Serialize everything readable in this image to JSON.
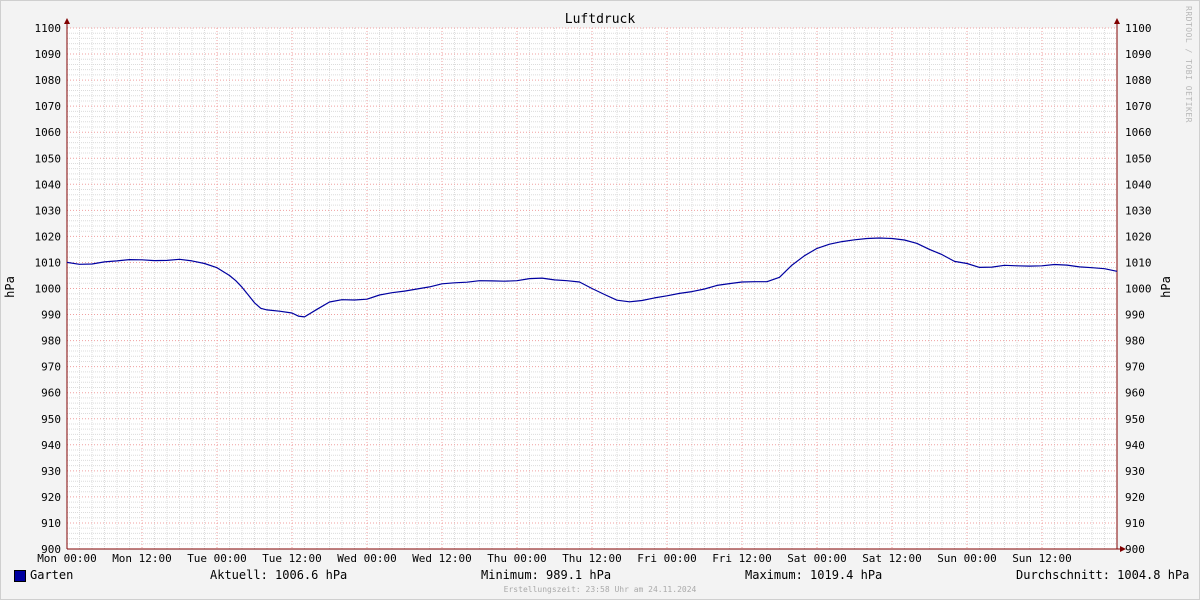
{
  "chart_data": {
    "type": "line",
    "title": "Luftdruck",
    "xlabel": "",
    "ylabel": "hPa",
    "ylabel_right": "hPa",
    "ylim": [
      900,
      1100
    ],
    "yticks": [
      900,
      910,
      920,
      930,
      940,
      950,
      960,
      970,
      980,
      990,
      1000,
      1010,
      1020,
      1030,
      1040,
      1050,
      1060,
      1070,
      1080,
      1090,
      1100
    ],
    "xlim": [
      0,
      168
    ],
    "xticks": [
      {
        "value": 0,
        "label": "Mon 00:00"
      },
      {
        "value": 12,
        "label": "Mon 12:00"
      },
      {
        "value": 24,
        "label": "Tue 00:00"
      },
      {
        "value": 36,
        "label": "Tue 12:00"
      },
      {
        "value": 48,
        "label": "Wed 00:00"
      },
      {
        "value": 60,
        "label": "Wed 12:00"
      },
      {
        "value": 72,
        "label": "Thu 00:00"
      },
      {
        "value": 84,
        "label": "Thu 12:00"
      },
      {
        "value": 96,
        "label": "Fri 00:00"
      },
      {
        "value": 108,
        "label": "Fri 12:00"
      },
      {
        "value": 120,
        "label": "Sat 00:00"
      },
      {
        "value": 132,
        "label": "Sat 12:00"
      },
      {
        "value": 144,
        "label": "Sun 00:00"
      },
      {
        "value": 156,
        "label": "Sun 12:00"
      }
    ],
    "grid": true,
    "series": [
      {
        "name": "Garten",
        "color": "#0000a0",
        "x": [
          0,
          2,
          4,
          6,
          8,
          10,
          12,
          14,
          16,
          18,
          20,
          22,
          24,
          26,
          27,
          28,
          29,
          30,
          31,
          32,
          34,
          36,
          37,
          38,
          40,
          42,
          44,
          46,
          48,
          50,
          52,
          54,
          56,
          58,
          60,
          62,
          64,
          66,
          68,
          70,
          72,
          74,
          76,
          78,
          80,
          82,
          84,
          86,
          88,
          90,
          92,
          94,
          96,
          98,
          100,
          102,
          104,
          106,
          108,
          110,
          112,
          114,
          116,
          118,
          120,
          122,
          124,
          126,
          128,
          130,
          132,
          134,
          136,
          138,
          140,
          142,
          144,
          146,
          148,
          150,
          152,
          154,
          156,
          158,
          160,
          162,
          164,
          166,
          168
        ],
        "values": [
          1010,
          1009.3,
          1009.4,
          1010.2,
          1010.6,
          1011.1,
          1011.0,
          1010.7,
          1010.8,
          1011.2,
          1010.6,
          1009.6,
          1008.0,
          1005.0,
          1003.0,
          1000.5,
          997.5,
          994.5,
          992.4,
          991.8,
          991.3,
          990.6,
          989.4,
          989.1,
          992.0,
          994.8,
          995.7,
          995.6,
          995.9,
          997.5,
          998.4,
          999.0,
          999.8,
          1000.6,
          1001.8,
          1002.2,
          1002.4,
          1003.0,
          1002.9,
          1002.8,
          1003.0,
          1003.8,
          1004.0,
          1003.3,
          1003.0,
          1002.5,
          1000.0,
          997.7,
          995.5,
          994.9,
          995.4,
          996.4,
          997.2,
          998.1,
          998.8,
          999.8,
          1001.2,
          1001.9,
          1002.5,
          1002.6,
          1002.6,
          1004.3,
          1009.0,
          1012.6,
          1015.4,
          1017.0,
          1018.0,
          1018.7,
          1019.2,
          1019.4,
          1019.2,
          1018.6,
          1017.3,
          1015.0,
          1013.0,
          1010.4,
          1009.6,
          1008.1,
          1008.2,
          1008.9,
          1008.7,
          1008.6,
          1008.7,
          1009.2,
          1009.0,
          1008.3,
          1008.0,
          1007.6,
          1006.6
        ]
      }
    ]
  },
  "legend": {
    "series_name": "Garten",
    "swatch_color": "#0000a0",
    "current": "Aktuell: 1006.6 hPa",
    "minimum": "Minimum: 989.1 hPa",
    "maximum": "Maximum: 1019.4 hPa",
    "average": "Durchschnitt: 1004.8 hPa"
  },
  "footer": {
    "created": "Erstellungszeit: 23:58 Uhr am 24.11.2024"
  },
  "watermark": "RRDTOOL / TOBI OETIKER",
  "colors": {
    "background": "#f3f3f3",
    "plot_background": "#ffffff",
    "grid_minor": "#dcdcdc",
    "grid_major": "#f0a0a0",
    "axis": "#800000",
    "line": "#0000a0"
  }
}
